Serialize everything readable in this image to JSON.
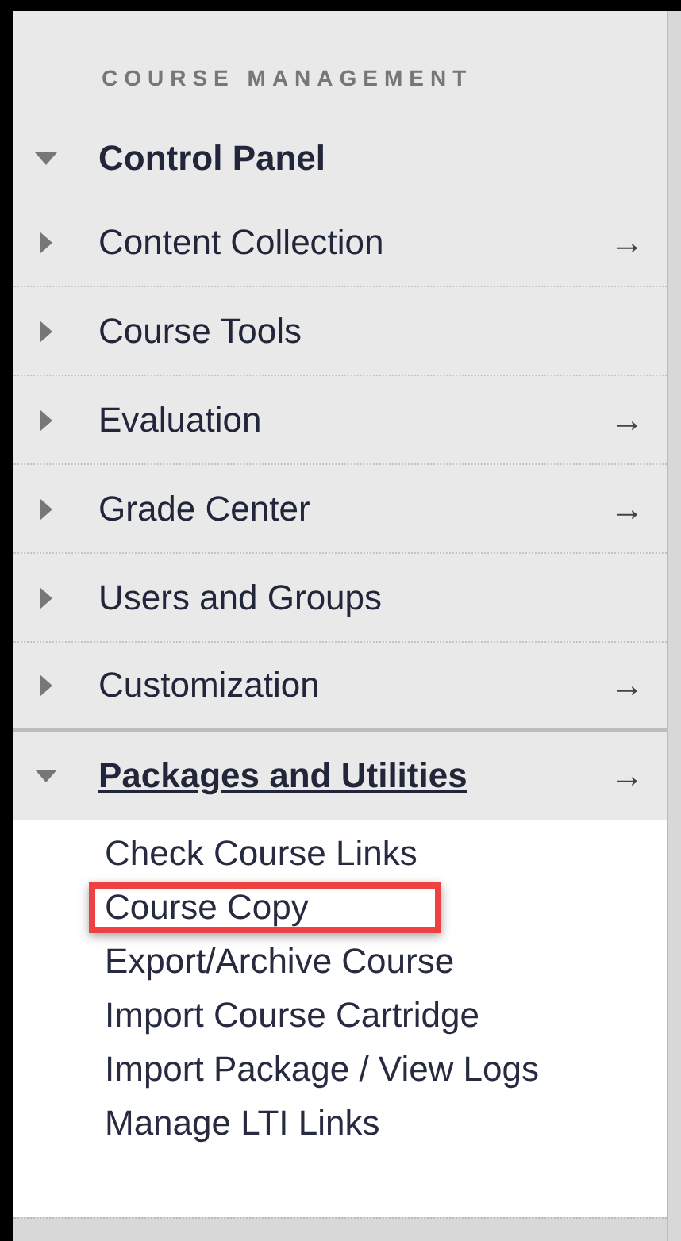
{
  "heading": "COURSE MANAGEMENT",
  "panel": {
    "label": "Control Panel",
    "expanded": true
  },
  "items": [
    {
      "label": "Content Collection",
      "expanded": false,
      "selected": false,
      "arrow": "→"
    },
    {
      "label": "Course Tools",
      "expanded": false,
      "selected": false
    },
    {
      "label": "Evaluation",
      "expanded": false,
      "selected": false,
      "arrow": "→"
    },
    {
      "label": "Grade Center",
      "expanded": false,
      "selected": false,
      "arrow": "→"
    },
    {
      "label": "Users and Groups",
      "expanded": false,
      "selected": false
    },
    {
      "label": "Customization",
      "expanded": false,
      "selected": false,
      "arrow": "→"
    },
    {
      "label": "Packages and Utilities",
      "expanded": true,
      "selected": true,
      "arrow": "→",
      "children": [
        {
          "label": "Check Course Links",
          "highlighted": false
        },
        {
          "label": "Course Copy",
          "highlighted": true
        },
        {
          "label": "Export/Archive Course",
          "highlighted": false
        },
        {
          "label": "Import Course Cartridge",
          "highlighted": false
        },
        {
          "label": "Import Package / View Logs",
          "highlighted": false
        },
        {
          "label": "Manage LTI Links",
          "highlighted": false
        }
      ]
    }
  ]
}
